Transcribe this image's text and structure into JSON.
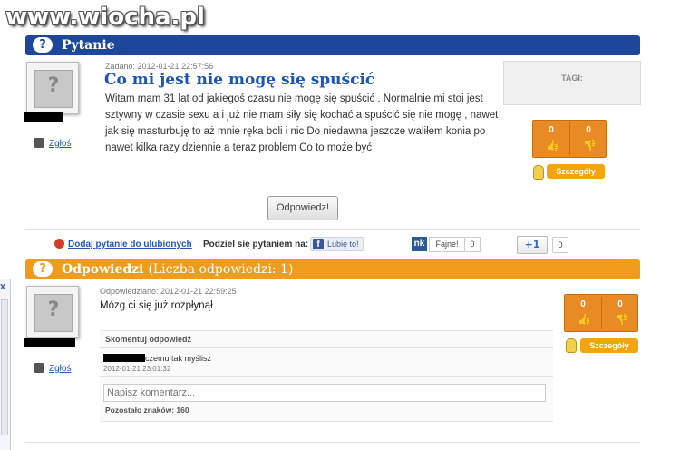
{
  "watermark": "www.wiocha.pl",
  "question": {
    "header": "Pytanie",
    "badge": "?",
    "avatar_glyph": "?",
    "report_label": "Zgłoś",
    "date_label": "Zadano: 2012-01-21 22:57:56",
    "title": "Co mi jest nie mogę się spuścić",
    "body": "Witam mam 31 lat od jakiegoś czasu nie mogę się spuścić . Normalnie mi stoi jest sztywny w czasie sexu a i już nie mam siły się kochać a spuścić się nie mogę , nawet jak się masturbuję to aż mnie ręka boli i nic Do niedawna jeszcze waliłem konia po nawet kilka razy dziennie a teraz problem Co to może być",
    "tags_label": "TAGI:",
    "votes_up": "0",
    "votes_down": "0",
    "details_label": "Szczegóły",
    "answer_button": "Odpowiedz!"
  },
  "share": {
    "favorite_label": "Dodaj pytanie do ulubionych",
    "share_label": "Podziel się pytaniem na:",
    "fb_label": "Lubię to!",
    "nk_logo": "nk",
    "nk_label": "Fajne!",
    "nk_count": "0",
    "gplus_label": "+1",
    "gplus_count": "0"
  },
  "answers": {
    "header_main": "Odpowiedzi",
    "header_count": "(Liczba odpowiedzi: 1)",
    "badge": "?",
    "items": [
      {
        "avatar_glyph": "?",
        "date_label": "Odpowiedziano: 2012-01-21 22:59:25",
        "text": "Mózg ci się już rozpłynął",
        "report_label": "Zgłoś",
        "votes_up": "0",
        "votes_down": "0",
        "details_label": "Szczegóły",
        "comment_section_label": "Skomentuj odpowiedź",
        "comments": [
          {
            "text": "czemu tak myślisz",
            "date": "2012-01-21 23:01:32"
          }
        ],
        "comment_placeholder": "Napisz komentarz...",
        "chars_left_label": "Pozostało znaków: 160"
      }
    ]
  },
  "sidebar_widget": {
    "close_glyph": "x"
  },
  "colors": {
    "blue_bar": "#1c479a",
    "orange_bar": "#ef9b1c",
    "link": "#2356b8",
    "vote_bg": "#e88b24"
  }
}
